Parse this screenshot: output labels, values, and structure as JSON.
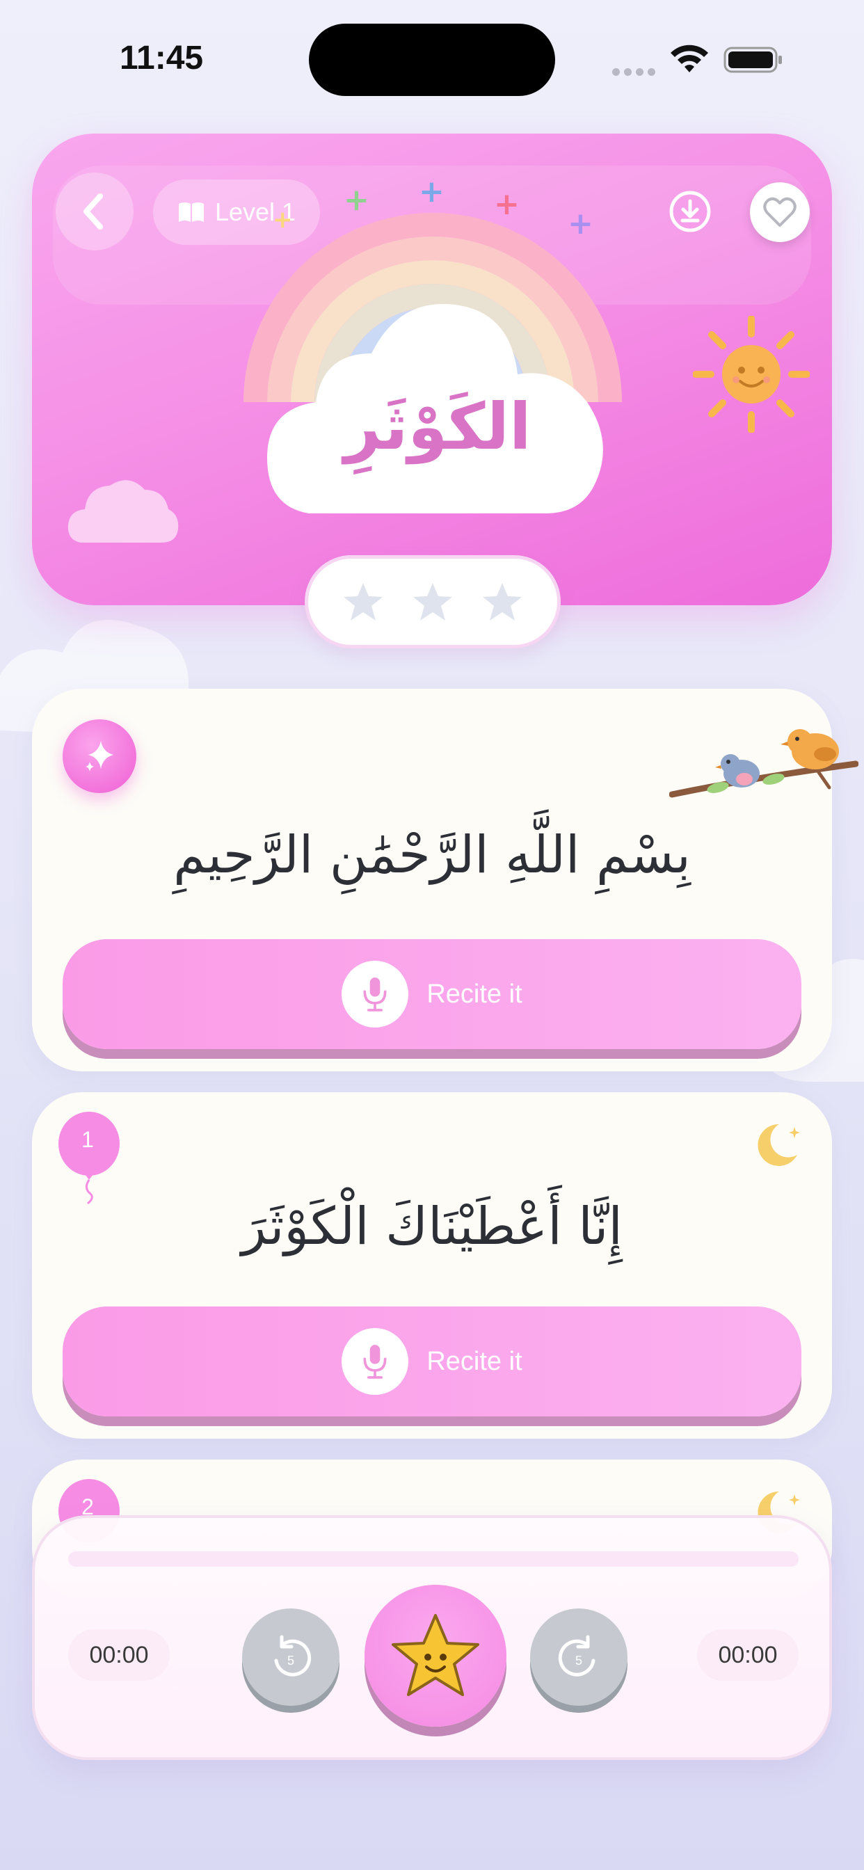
{
  "status_bar": {
    "time": "11:45"
  },
  "header": {
    "level_label": "Level 1",
    "surah_title": "الكَوْثَرِ",
    "star_rating": {
      "earned": 0,
      "total": 3
    }
  },
  "verses": [
    {
      "number": "",
      "text": "بِسْمِ اللَّهِ الرَّحْمَٰنِ الرَّحِيمِ",
      "recite_label": "Recite it"
    },
    {
      "number": "1",
      "text": "إِنَّا أَعْطَيْنَاكَ الْكَوْثَرَ",
      "recite_label": "Recite it"
    },
    {
      "number": "2"
    }
  ],
  "player": {
    "current_time": "00:00",
    "total_time": "00:00",
    "progress": 0,
    "rewind_seconds": "5",
    "forward_seconds": "5"
  },
  "colors": {
    "accent_pink": "#f58fe4",
    "card_bg": "#fdfcf7",
    "title_pink": "#d873c6"
  }
}
